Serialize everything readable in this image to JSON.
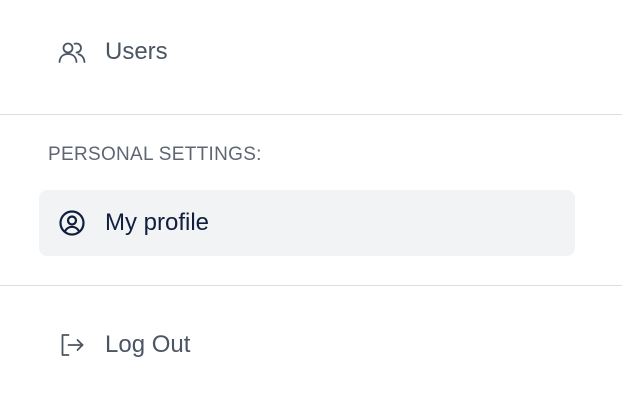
{
  "nav": {
    "users": {
      "label": "Users",
      "icon": "users-icon"
    },
    "section_heading": "PERSONAL SETTINGS:",
    "my_profile": {
      "label": "My profile",
      "icon": "user-circle-icon",
      "active": true
    },
    "logout": {
      "label": "Log Out",
      "icon": "logout-icon"
    }
  },
  "colors": {
    "active_bg": "#f2f3f5",
    "active_text": "#0f1f3d",
    "text": "#4b5563",
    "divider": "#dcdee2"
  }
}
